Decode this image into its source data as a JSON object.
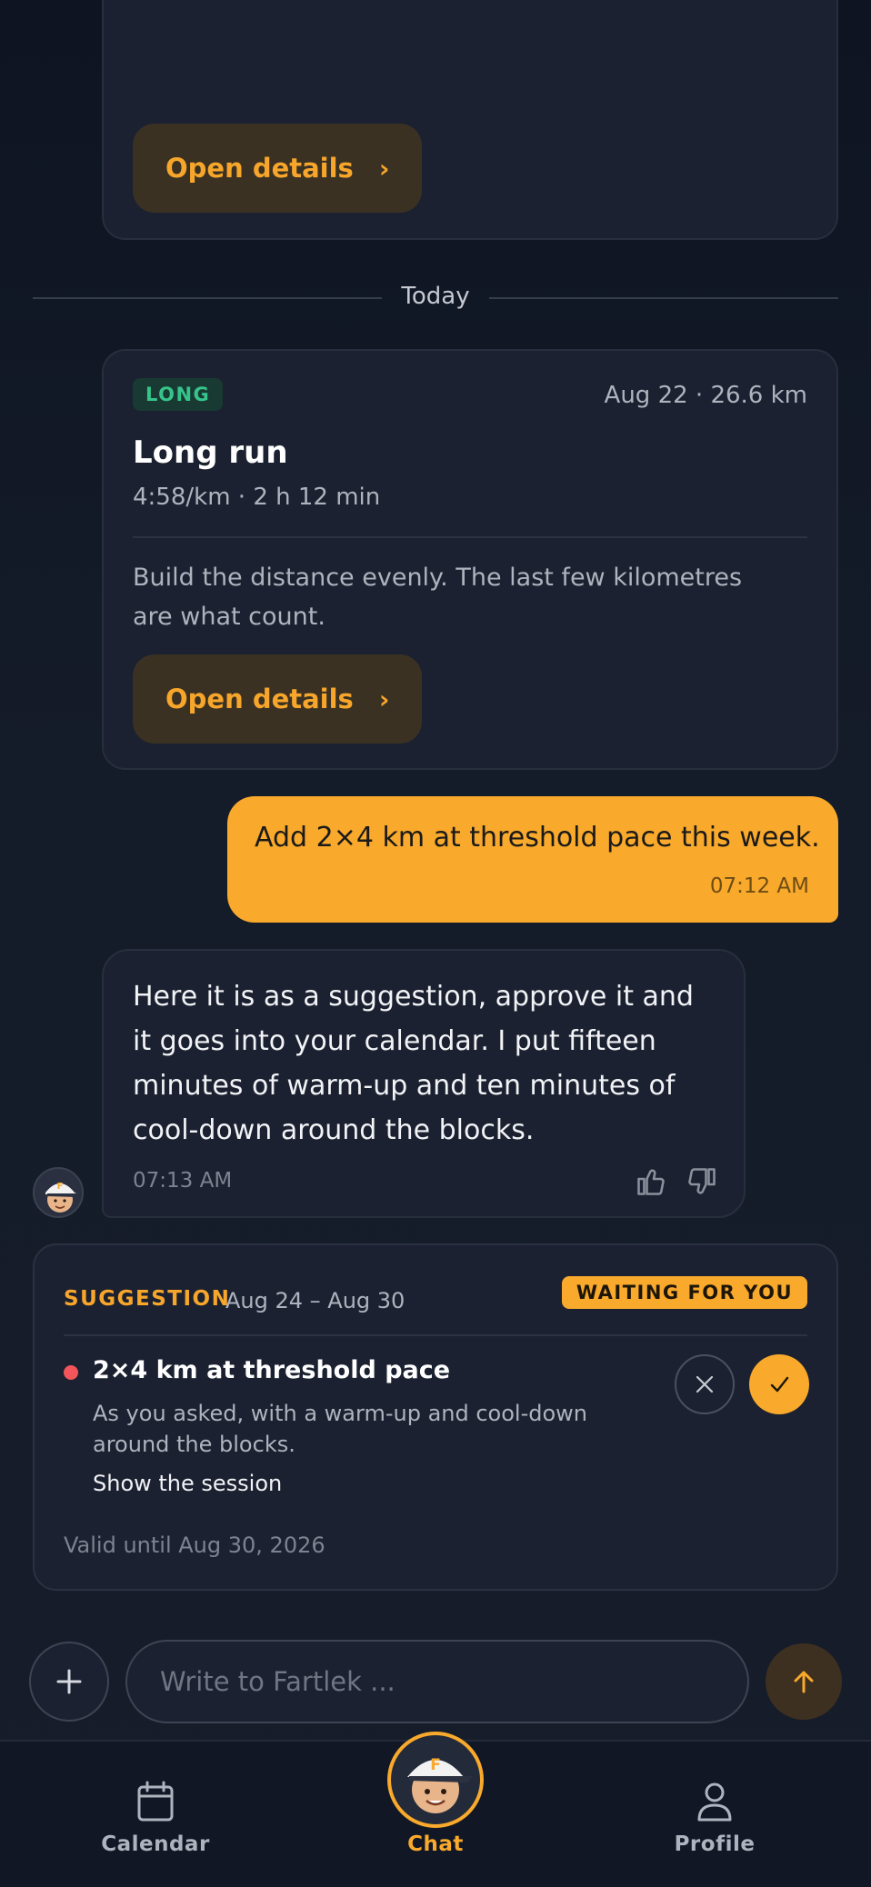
{
  "previous_card": {
    "open_label": "Open details"
  },
  "divider": {
    "label": "Today"
  },
  "workout": {
    "badge": "LONG",
    "meta": "Aug 22 · 26.6 km",
    "title": "Long run",
    "subtitle": "4:58/km · 2 h 12 min",
    "description": "Build the distance evenly. The last few kilometres are what count.",
    "open_label": "Open details"
  },
  "user_message": {
    "text": "Add 2×4 km at threshold pace this week.",
    "time": "07:12 AM"
  },
  "bot_message": {
    "text": "Here it is as a suggestion, approve it and it goes into your calendar. I put fifteen minutes of warm-up and ten minutes of cool-down around the blocks.",
    "time": "07:13 AM",
    "avatar_icon": "coach-avatar-icon",
    "like_icon": "thumbs-up-icon",
    "dislike_icon": "thumbs-down-icon"
  },
  "suggestion": {
    "label": "SUGGESTION",
    "range": "Aug 24 – Aug 30",
    "status": "WAITING FOR YOU",
    "title": "2×4 km at threshold pace",
    "description": "As you asked, with a warm-up and cool-down around the blocks.",
    "link": "Show the session",
    "valid": "Valid until Aug 30, 2026",
    "reject_icon": "close-icon",
    "approve_icon": "check-icon"
  },
  "composer": {
    "placeholder": "Write to Fartlek ...",
    "plus_icon": "plus-icon",
    "send_icon": "arrow-up-icon"
  },
  "nav": {
    "items": [
      {
        "label": "Calendar",
        "icon": "calendar-icon"
      },
      {
        "label": "Chat",
        "icon": "coach-avatar-icon"
      },
      {
        "label": "Profile",
        "icon": "person-icon"
      }
    ]
  },
  "colors": {
    "accent": "#f9a92b",
    "badge_green": "#36c48b",
    "dot_red": "#f2555a",
    "background": "#121826",
    "card": "#1b2130"
  }
}
